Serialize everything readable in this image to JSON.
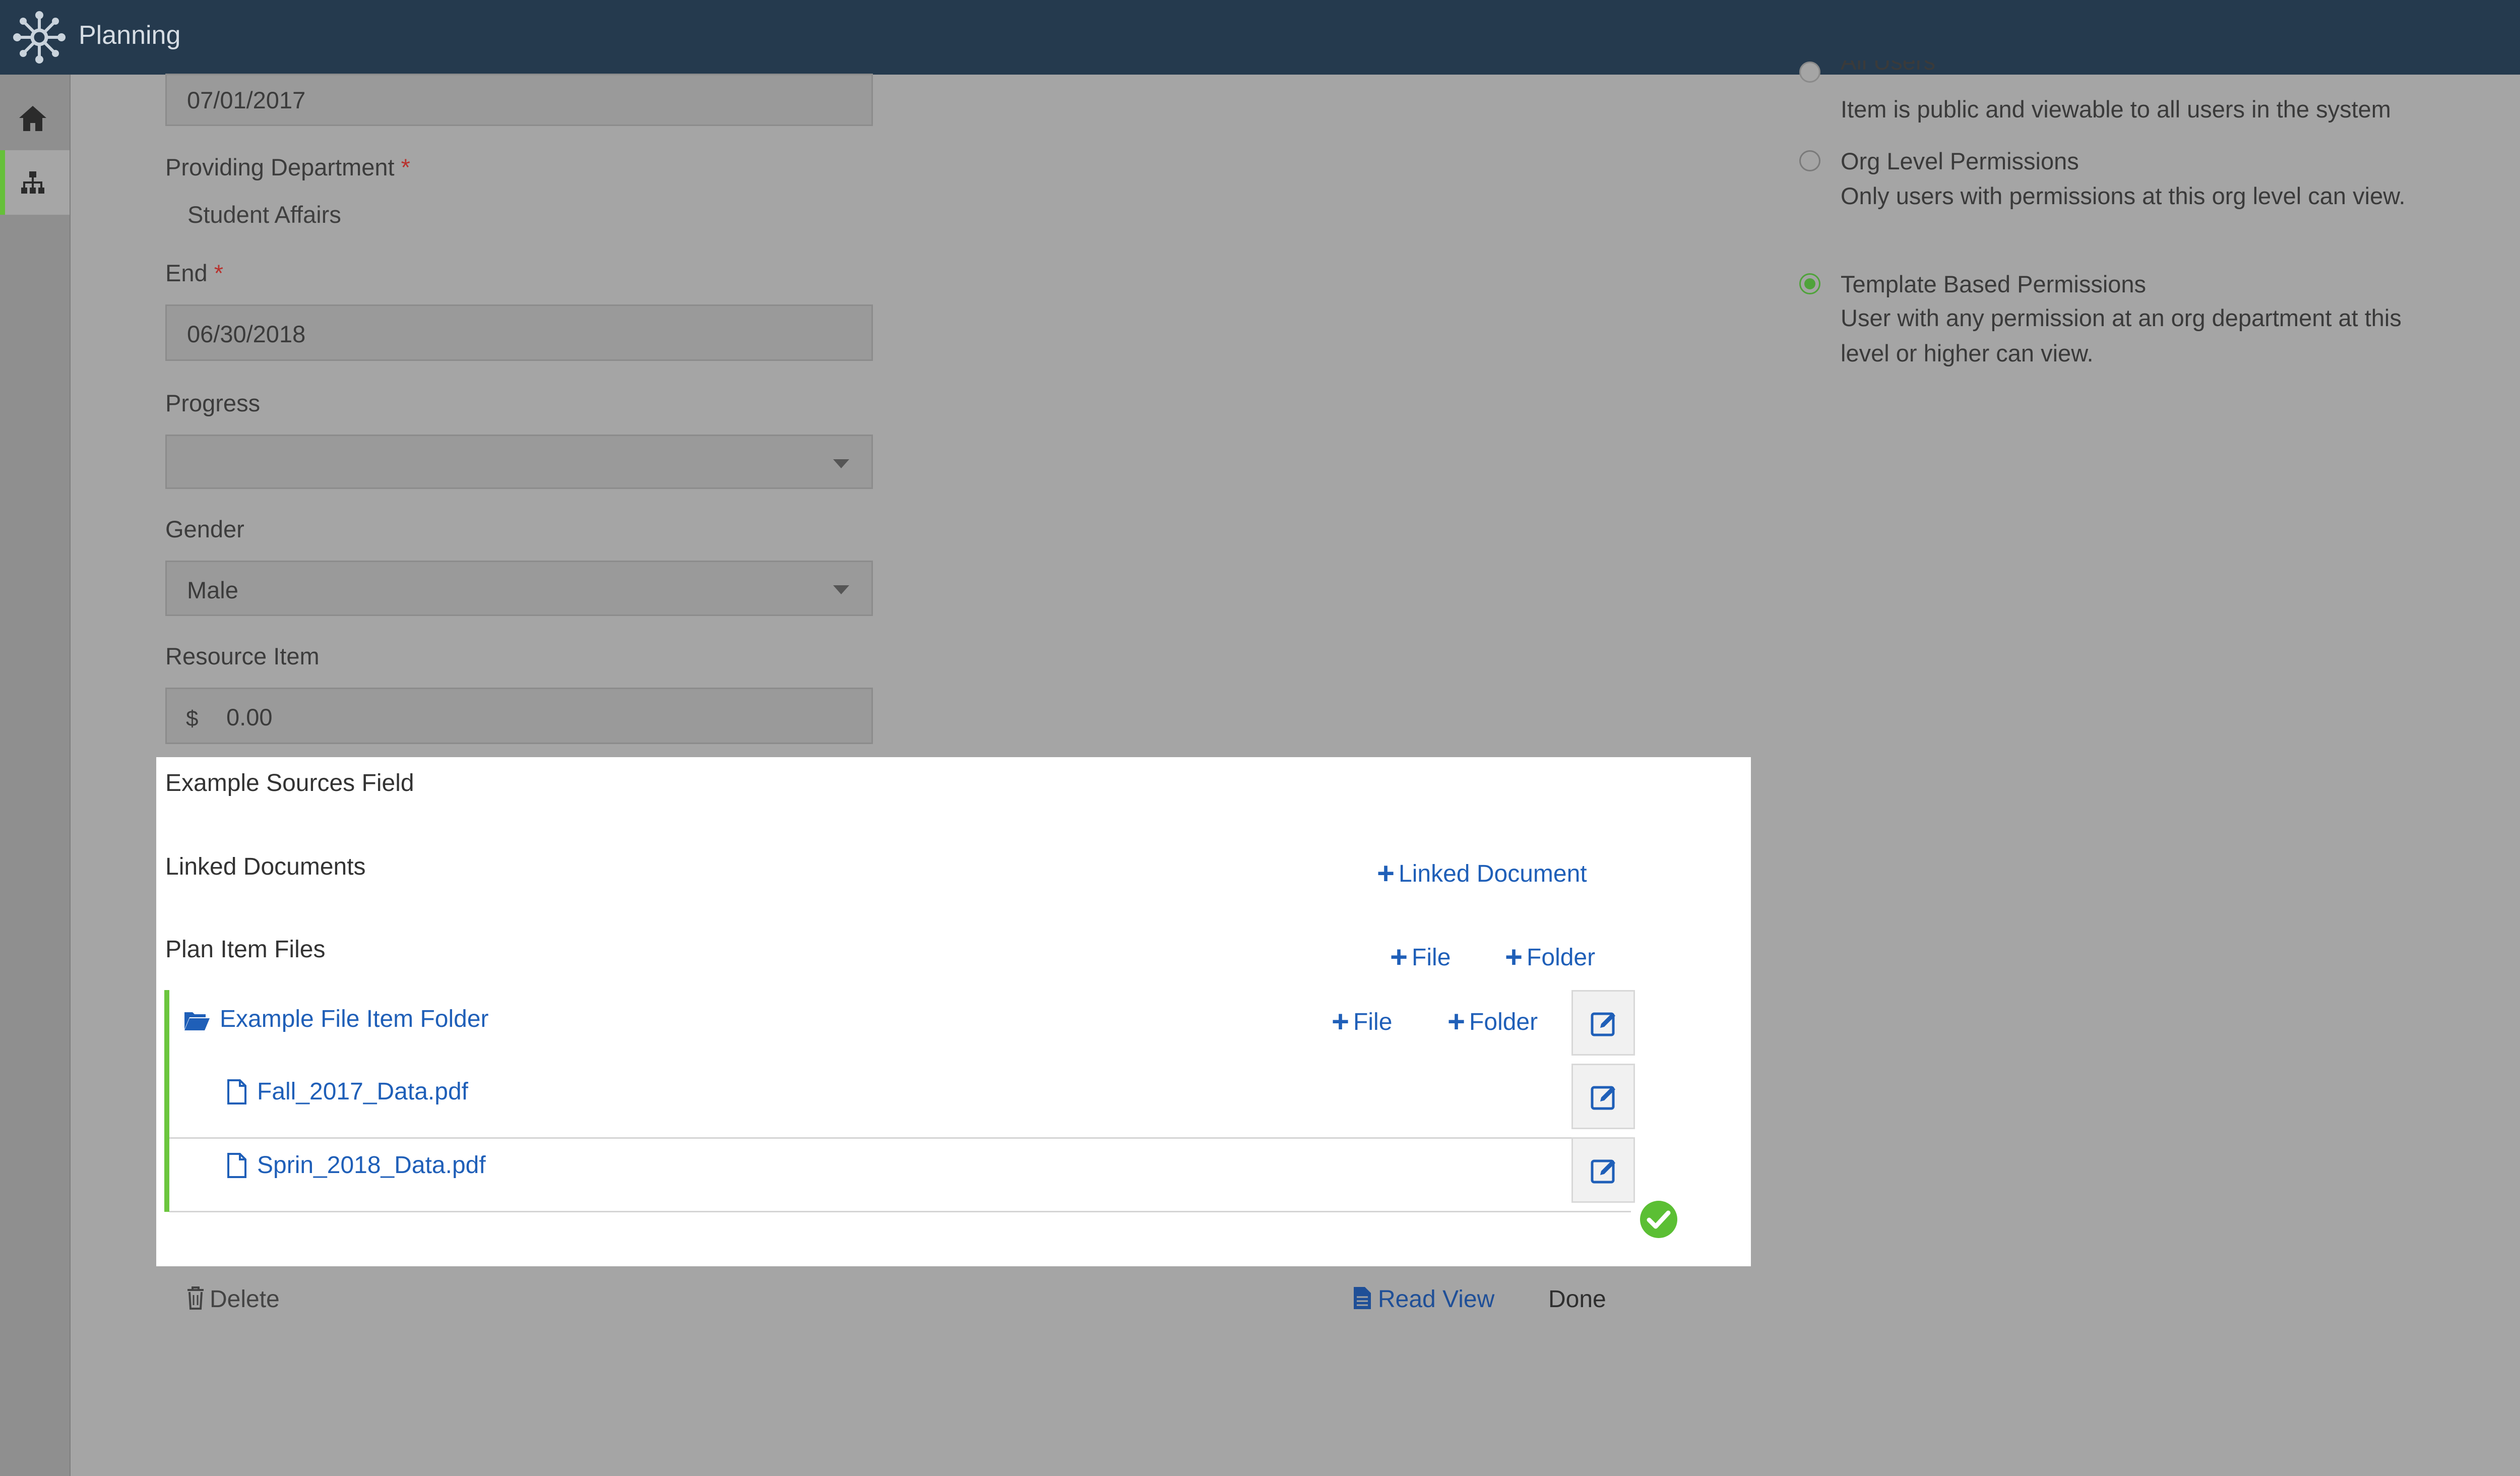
{
  "app": {
    "title": "Planning"
  },
  "sidebar": {
    "items": [
      {
        "icon": "home-icon"
      },
      {
        "icon": "hierarchy-icon",
        "active": true
      }
    ]
  },
  "form": {
    "start_value": "07/01/2017",
    "providing_department": {
      "label": "Providing Department",
      "required": "*",
      "value": "Student Affairs"
    },
    "end": {
      "label": "End",
      "required": "*",
      "value": "06/30/2018"
    },
    "progress": {
      "label": "Progress",
      "value": ""
    },
    "gender": {
      "label": "Gender",
      "value": "Male"
    },
    "resource_item": {
      "label": "Resource Item",
      "prefix": "$",
      "value": "0.00"
    }
  },
  "permissions": {
    "options": [
      {
        "title": "All Users",
        "desc": "Item is public and viewable to all users in the system",
        "checked": false
      },
      {
        "title": "Org Level Permissions",
        "desc": "Only users with permissions at this org level can view.",
        "checked": false
      },
      {
        "title": "Template Based Permissions",
        "desc": "User with any permission at an org department at this level or higher can view.",
        "checked": true
      }
    ]
  },
  "panel": {
    "sources_label": "Example Sources Field",
    "linked_documents_label": "Linked Documents",
    "add_linked_document": "Linked Document",
    "plan_item_files_label": "Plan Item Files",
    "add_file": "File",
    "add_folder": "Folder",
    "folder_name": "Example File Item Folder",
    "files": [
      "Fall_2017_Data.pdf",
      "Sprin_2018_Data.pdf"
    ]
  },
  "footer": {
    "delete": "Delete",
    "read_view": "Read View",
    "done": "Done"
  },
  "colors": {
    "topbar": "#253a4e",
    "accent_green": "#66c03a",
    "link_blue": "#1f5fb8"
  }
}
